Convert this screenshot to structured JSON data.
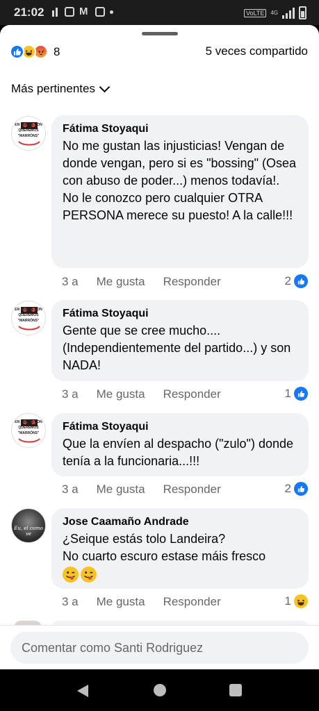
{
  "status_bar": {
    "time": "21:02",
    "network_label": "VoLTE",
    "network_type": "4G"
  },
  "post_summary": {
    "reaction_count": "8",
    "shares": "5 veces compartido",
    "reactions": [
      "like",
      "haha",
      "angry"
    ]
  },
  "sort": {
    "label": "Más pertinentes"
  },
  "comments": [
    {
      "author": "Fátima Stoyaqui",
      "text": "No me gustan las injusticias! Vengan de donde vengan, pero si es \"bossing\" (Osea con abuso de poder...) menos todavía!.\nNo le conozco pero cualquier OTRA PERSONA merece su puesto! A la calle!!!",
      "time": "3 a",
      "like_label": "Me gusta",
      "reply_label": "Responder",
      "reactions": "2",
      "reaction_type": "like",
      "avatar_text": "EN MUROS NON QUEREMOS \"MARRÓNS\""
    },
    {
      "author": "Fátima Stoyaqui",
      "text": "Gente que se cree mucho.... (Independientemente del partido...) y son NADA!",
      "time": "3 a",
      "like_label": "Me gusta",
      "reply_label": "Responder",
      "reactions": "1",
      "reaction_type": "like",
      "avatar_text": "EN MUROS NON QUEREMOS \"MARRÓNS\""
    },
    {
      "author": "Fátima Stoyaqui",
      "text": "Que la envíen al despacho (\"zulo\") donde tenía a la funcionaria...!!!",
      "time": "3 a",
      "like_label": "Me gusta",
      "reply_label": "Responder",
      "reactions": "2",
      "reaction_type": "like",
      "avatar_text": "EN MUROS NON QUEREMOS \"MARRÓNS\""
    },
    {
      "author": "Jose Caamaño Andrade",
      "text": "¿Seique estás tolo Landeira?\nNo cuarto escuro estase máis fresco",
      "time": "3 a",
      "like_label": "Me gusta",
      "reply_label": "Responder",
      "reactions": "1",
      "reaction_type": "haha",
      "avatar_text": "Eu, el como ve"
    }
  ],
  "composer": {
    "placeholder": "Comentar como Santi Rodriguez"
  },
  "colors": {
    "accent": "#1877f2",
    "bubble": "#f0f2f5",
    "muted": "#65676b"
  }
}
